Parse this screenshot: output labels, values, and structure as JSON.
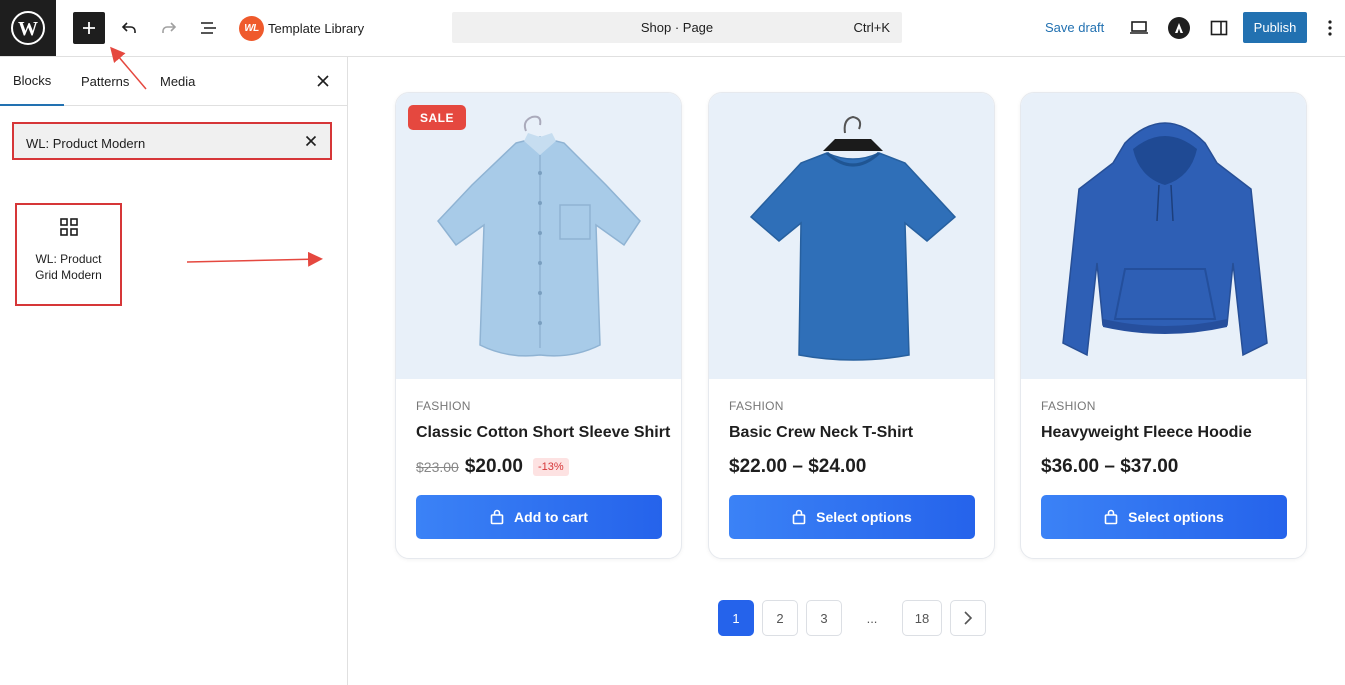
{
  "topbar": {
    "template_library_logo": "WL",
    "template_library_label": "Template Library",
    "command_title": "Shop · Page",
    "command_shortcut": "Ctrl+K",
    "save_draft_label": "Save draft",
    "publish_label": "Publish"
  },
  "panel": {
    "tabs": [
      {
        "label": "Blocks",
        "active": true
      },
      {
        "label": "Patterns",
        "active": false
      },
      {
        "label": "Media",
        "active": false
      }
    ],
    "search_value": "WL: Product Modern",
    "result_block_label": "WL: Product Grid Modern"
  },
  "products": [
    {
      "category": "FASHION",
      "title": "Classic Cotton Short Sleeve Shirt",
      "sale_badge": "SALE",
      "price_old": "$23.00",
      "price": "$20.00",
      "discount": "-13%",
      "button_label": "Add to cart",
      "image": "light-blue-shirt"
    },
    {
      "category": "FASHION",
      "title": "Basic Crew Neck T-Shirt",
      "price": "$22.00 – $24.00",
      "button_label": "Select options",
      "image": "blue-tshirt"
    },
    {
      "category": "FASHION",
      "title": "Heavyweight Fleece Hoodie",
      "price": "$36.00 – $37.00",
      "button_label": "Select options",
      "image": "blue-hoodie"
    }
  ],
  "pagination": {
    "pages": [
      "1",
      "2",
      "3",
      "...",
      "18"
    ],
    "current": "1"
  },
  "colors": {
    "accent": "#2271b1",
    "button_blue": "#2563eb",
    "sale_red": "#e5483f",
    "highlight_red": "#d63638"
  }
}
